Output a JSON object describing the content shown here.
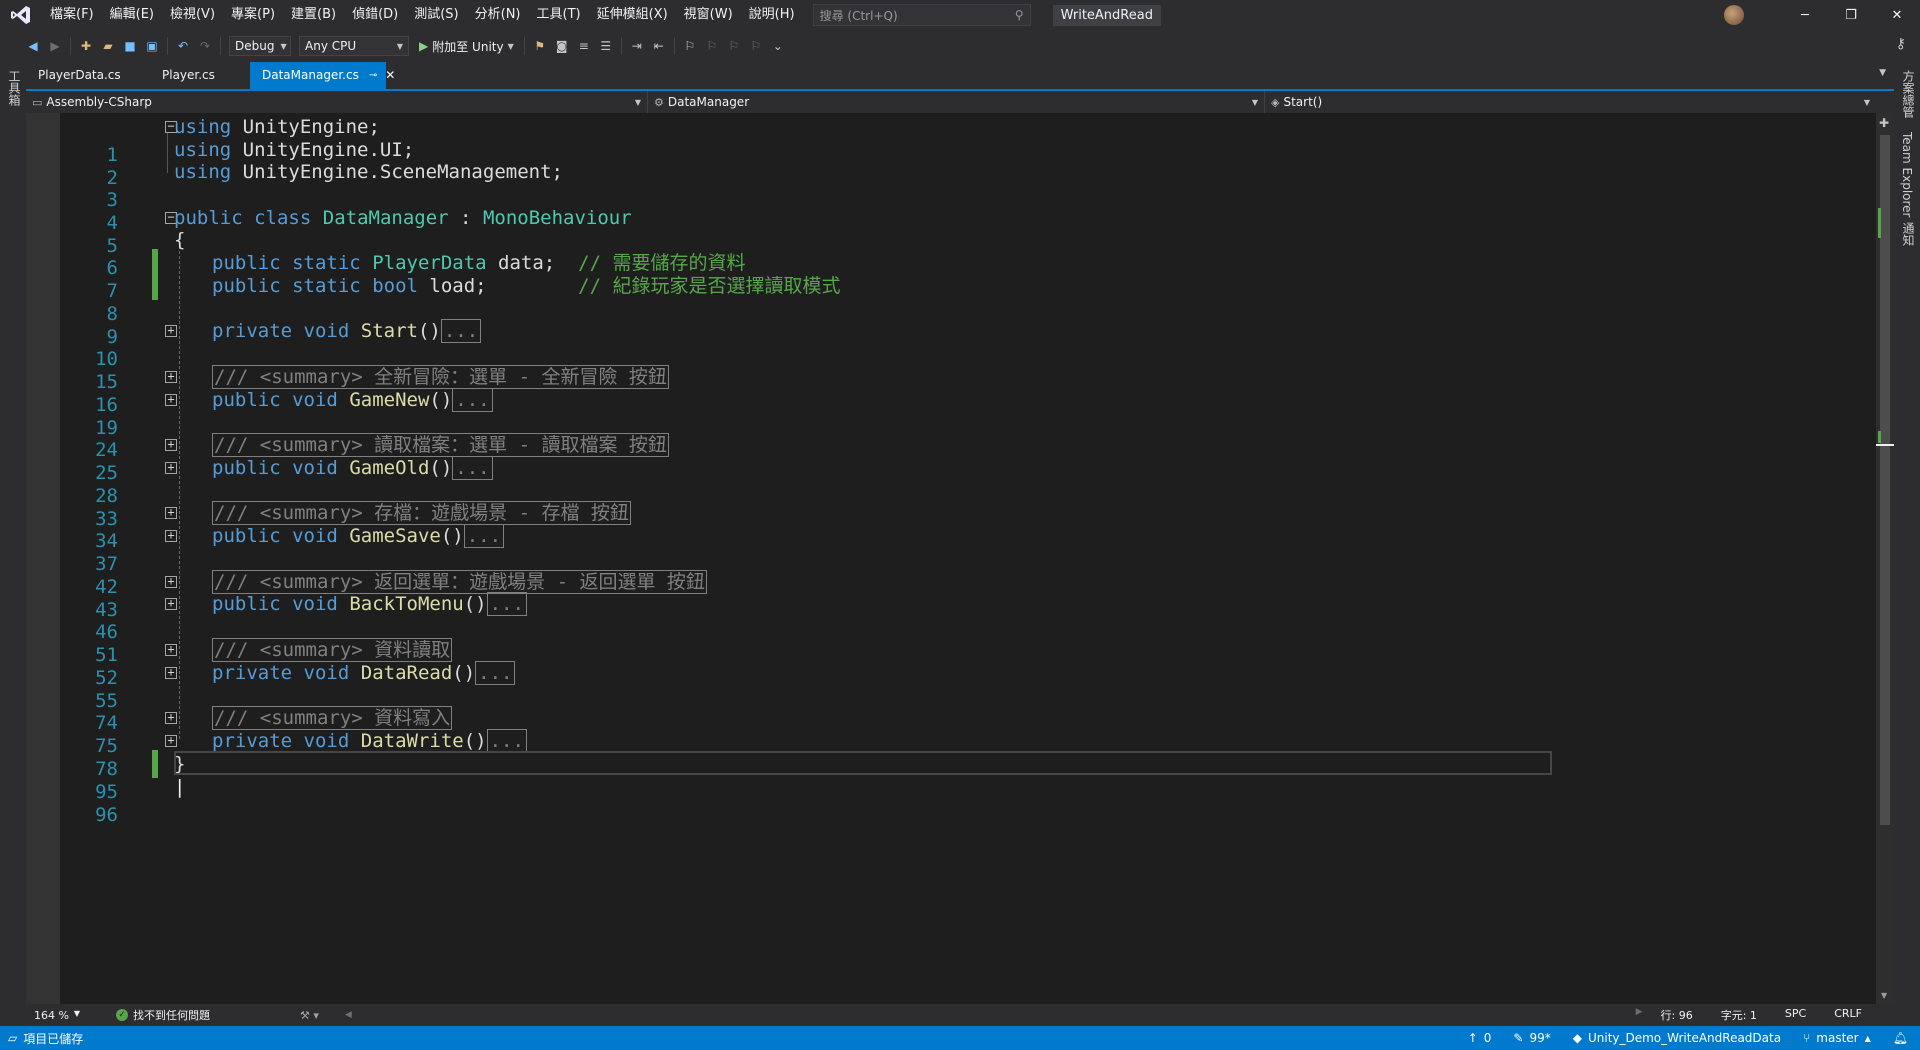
{
  "menu": {
    "items": [
      "檔案(F)",
      "編輯(E)",
      "檢視(V)",
      "專案(P)",
      "建置(B)",
      "偵錯(D)",
      "測試(S)",
      "分析(N)",
      "工具(T)",
      "延伸模組(X)",
      "視窗(W)",
      "說明(H)"
    ],
    "search_placeholder": "搜尋 (Ctrl+Q)",
    "solution_name": "WriteAndRead"
  },
  "toolbar": {
    "config": "Debug",
    "platform": "Any CPU",
    "attach_label": "附加至 Unity"
  },
  "side_panels": {
    "left_label": "工具箱",
    "right_top_label": "方案總管",
    "right_mid_label": "Team Explorer",
    "right_bottom_label": "通知"
  },
  "tabs": [
    {
      "label": "PlayerData.cs",
      "active": false
    },
    {
      "label": "Player.cs",
      "active": false
    },
    {
      "label": "DataManager.cs",
      "active": true
    }
  ],
  "navbar": {
    "project": "Assembly-CSharp",
    "type": "DataManager",
    "member": "Start()"
  },
  "code": {
    "lines": [
      {
        "n": "1",
        "text": "using UnityEngine;"
      },
      {
        "n": "2",
        "text": "using UnityEngine.UI;"
      },
      {
        "n": "3",
        "text": "using UnityEngine.SceneManagement;"
      },
      {
        "n": "4",
        "text": ""
      },
      {
        "n": "5",
        "text": "public class DataManager : MonoBehaviour"
      },
      {
        "n": "6",
        "text": "{"
      },
      {
        "n": "7",
        "text": "public static PlayerData data;",
        "comment": "// 需要儲存的資料"
      },
      {
        "n": "8",
        "text": "public static bool load;",
        "comment": "// 紀錄玩家是否選擇讀取模式"
      },
      {
        "n": "9",
        "text": ""
      },
      {
        "n": "10",
        "text": "private void Start()"
      },
      {
        "n": "15",
        "text": ""
      },
      {
        "n": "16",
        "text": "/// <summary> 全新冒險：選單 - 全新冒險 按鈕"
      },
      {
        "n": "19",
        "text": "public void GameNew()"
      },
      {
        "n": "24",
        "text": ""
      },
      {
        "n": "25",
        "text": "/// <summary> 讀取檔案：選單 - 讀取檔案 按鈕"
      },
      {
        "n": "28",
        "text": "public void GameOld()"
      },
      {
        "n": "33",
        "text": ""
      },
      {
        "n": "34",
        "text": "/// <summary> 存檔：遊戲場景 - 存檔 按鈕"
      },
      {
        "n": "37",
        "text": "public void GameSave()"
      },
      {
        "n": "42",
        "text": ""
      },
      {
        "n": "43",
        "text": "/// <summary> 返回選單：遊戲場景 - 返回選單 按鈕"
      },
      {
        "n": "46",
        "text": "public void BackToMenu()"
      },
      {
        "n": "51",
        "text": ""
      },
      {
        "n": "52",
        "text": "/// <summary> 資料讀取"
      },
      {
        "n": "55",
        "text": "private void DataRead()"
      },
      {
        "n": "74",
        "text": ""
      },
      {
        "n": "75",
        "text": "/// <summary> 資料寫入"
      },
      {
        "n": "78",
        "text": "private void DataWrite()"
      },
      {
        "n": "95",
        "text": "}"
      },
      {
        "n": "96",
        "text": ""
      }
    ],
    "ellipsis": "..."
  },
  "editor_status": {
    "zoom": "164 %",
    "issues": "找不到任何問題",
    "line": "行: 96",
    "col": "字元: 1",
    "whitespace": "SPC",
    "eol": "CRLF"
  },
  "statusbar": {
    "left_text": "項目已儲存",
    "up_count": "0",
    "pending": "99*",
    "repo": "Unity_Demo_WriteAndReadData",
    "branch": "master"
  },
  "colors": {
    "accent": "#007acc",
    "keyword": "#569cd6",
    "type": "#4ec9b0",
    "method": "#dcdcaa",
    "comment": "#57a64a",
    "line_number": "#2b91af"
  }
}
